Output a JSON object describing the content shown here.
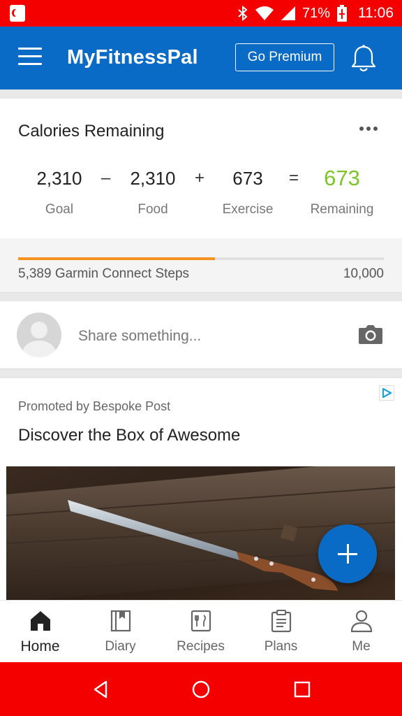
{
  "status_bar": {
    "battery": "71%",
    "time": "11:06",
    "icons": [
      "app-notification-icon",
      "bluetooth-icon",
      "wifi-icon",
      "signal-icon",
      "battery-charging-icon"
    ]
  },
  "app_bar": {
    "title": "MyFitnessPal",
    "premium_label": "Go Premium",
    "icons": [
      "menu-icon",
      "bell-icon"
    ]
  },
  "calories": {
    "title": "Calories Remaining",
    "goal_value": "2,310",
    "goal_label": "Goal",
    "minus": "–",
    "food_value": "2,310",
    "food_label": "Food",
    "plus": "+",
    "exercise_value": "673",
    "exercise_label": "Exercise",
    "equals": "=",
    "remaining_value": "673",
    "remaining_label": "Remaining",
    "remaining_color": "#7cc625"
  },
  "steps": {
    "label": "5,389 Garmin Connect Steps",
    "goal": "10,000",
    "progress_fraction": 0.539,
    "bar_color": "#f5931e"
  },
  "share": {
    "placeholder": "Share something..."
  },
  "promo": {
    "promoted_by": "Promoted by Bespoke Post",
    "title": "Discover the Box of Awesome"
  },
  "bottom_nav": {
    "items": [
      {
        "label": "Home",
        "icon": "home-icon"
      },
      {
        "label": "Diary",
        "icon": "diary-icon"
      },
      {
        "label": "Recipes",
        "icon": "recipes-icon"
      },
      {
        "label": "Plans",
        "icon": "plans-icon"
      },
      {
        "label": "Me",
        "icon": "me-icon"
      }
    ]
  },
  "colors": {
    "brand": "#0a6bc6",
    "status_bar": "#f40000"
  }
}
